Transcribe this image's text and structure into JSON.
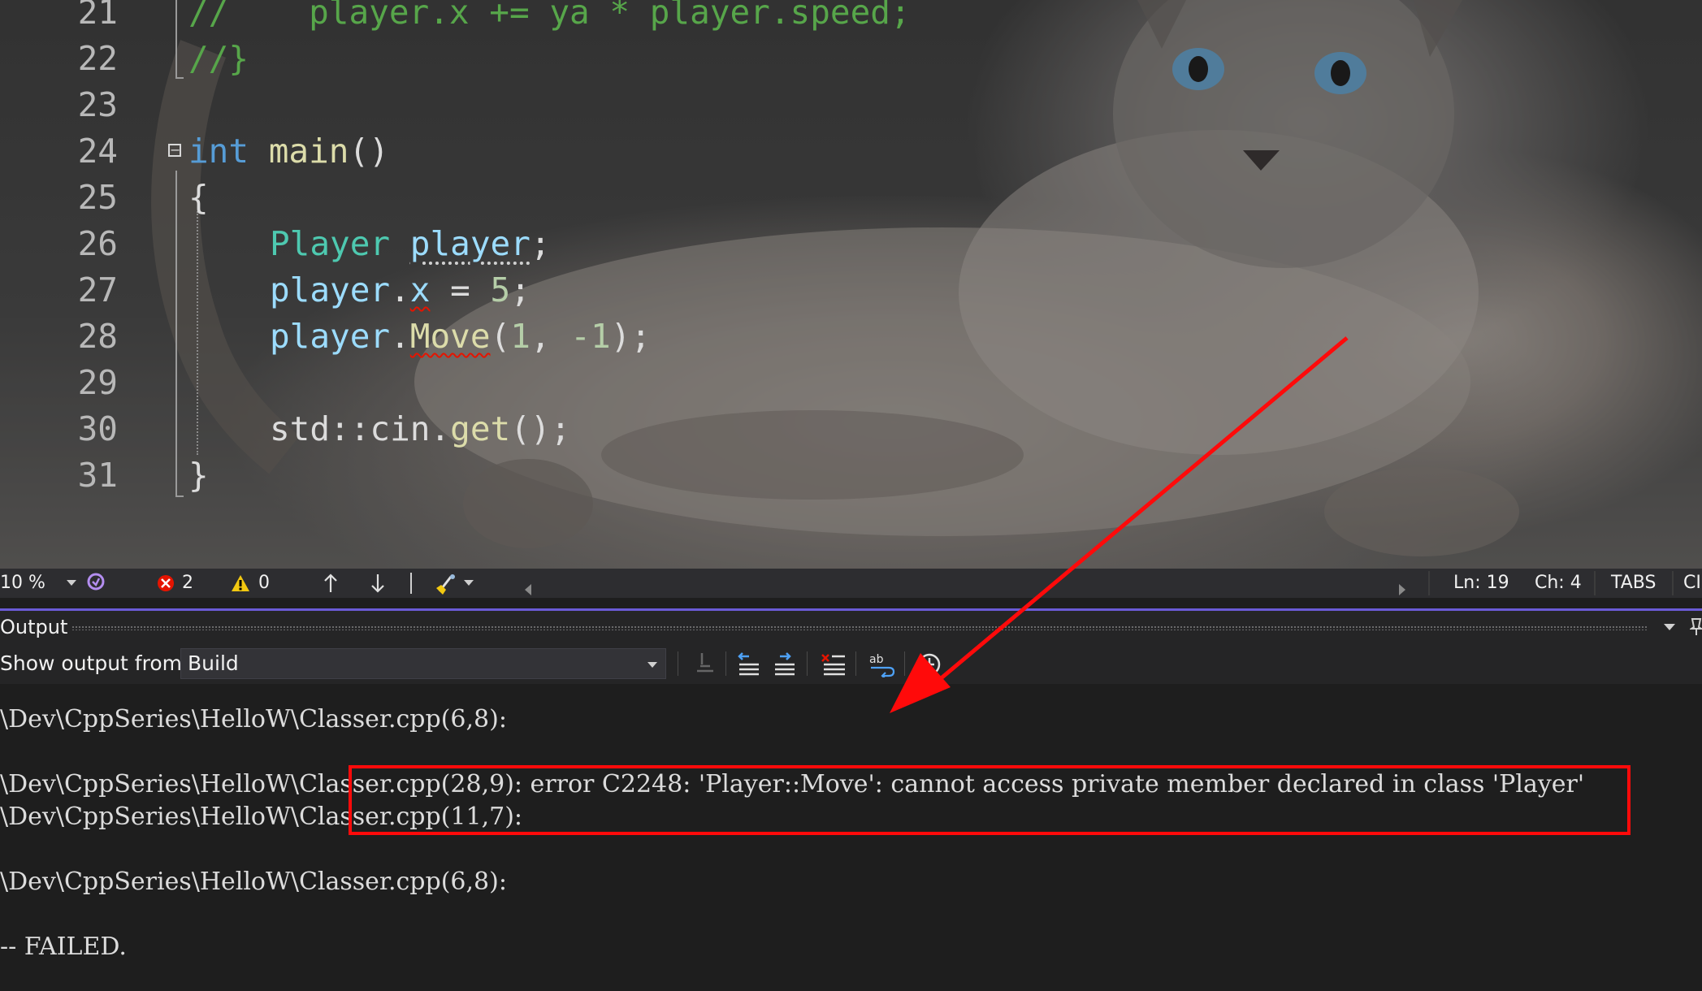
{
  "editor": {
    "lines": [
      {
        "num": "21",
        "tokens": [
          {
            "t": "//    player.x += ya * player.speed;",
            "c": "comment"
          }
        ]
      },
      {
        "num": "22",
        "tokens": [
          {
            "t": "//}",
            "c": "comment"
          }
        ]
      },
      {
        "num": "23",
        "tokens": []
      },
      {
        "num": "24",
        "tokens": [
          {
            "t": "int",
            "c": "kw"
          },
          {
            "t": " ",
            "c": "plain"
          },
          {
            "t": "main",
            "c": "fn"
          },
          {
            "t": "()",
            "c": "plain"
          }
        ]
      },
      {
        "num": "25",
        "tokens": [
          {
            "t": "{",
            "c": "plain"
          }
        ]
      },
      {
        "num": "26",
        "tokens": [
          {
            "t": "Player",
            "c": "type"
          },
          {
            "t": " ",
            "c": "plain"
          },
          {
            "t": "player",
            "c": "var",
            "deco": "dotted"
          },
          {
            "t": ";",
            "c": "plain"
          }
        ]
      },
      {
        "num": "27",
        "tokens": [
          {
            "t": "player",
            "c": "var"
          },
          {
            "t": ".",
            "c": "plain"
          },
          {
            "t": "x",
            "c": "var",
            "deco": "squiggle"
          },
          {
            "t": " = ",
            "c": "plain"
          },
          {
            "t": "5",
            "c": "num"
          },
          {
            "t": ";",
            "c": "plain"
          }
        ]
      },
      {
        "num": "28",
        "tokens": [
          {
            "t": "player",
            "c": "var"
          },
          {
            "t": ".",
            "c": "plain"
          },
          {
            "t": "Move",
            "c": "fn",
            "deco": "squiggle"
          },
          {
            "t": "(",
            "c": "plain"
          },
          {
            "t": "1",
            "c": "num"
          },
          {
            "t": ", ",
            "c": "plain"
          },
          {
            "t": "-1",
            "c": "num"
          },
          {
            "t": ");",
            "c": "plain"
          }
        ]
      },
      {
        "num": "29",
        "tokens": []
      },
      {
        "num": "30",
        "tokens": [
          {
            "t": "std::cin.",
            "c": "plain"
          },
          {
            "t": "get",
            "c": "fn"
          },
          {
            "t": "();",
            "c": "plain"
          }
        ]
      },
      {
        "num": "31",
        "tokens": [
          {
            "t": "}",
            "c": "plain"
          }
        ]
      }
    ]
  },
  "status": {
    "zoom": "10 %",
    "errors": "2",
    "warnings": "0",
    "line": "Ln: 19",
    "char": "Ch: 4",
    "indent": "TABS",
    "eol": "CI"
  },
  "output": {
    "title": "Output",
    "show_label": "Show output from:",
    "source": "Build",
    "lines": [
      "\\Dev\\CppSeries\\HelloW\\Classer.cpp(6,8):",
      "",
      "\\Dev\\CppSeries\\HelloW\\Classer.cpp(28,9): error C2248: 'Player::Move': cannot access private member declared in class 'Player'",
      "\\Dev\\CppSeries\\HelloW\\Classer.cpp(11,7):",
      "",
      "\\Dev\\CppSeries\\HelloW\\Classer.cpp(6,8):",
      "",
      "-- FAILED."
    ]
  },
  "colors": {
    "annotation": "#ff0a0a",
    "accent": "#6b5bd6"
  }
}
